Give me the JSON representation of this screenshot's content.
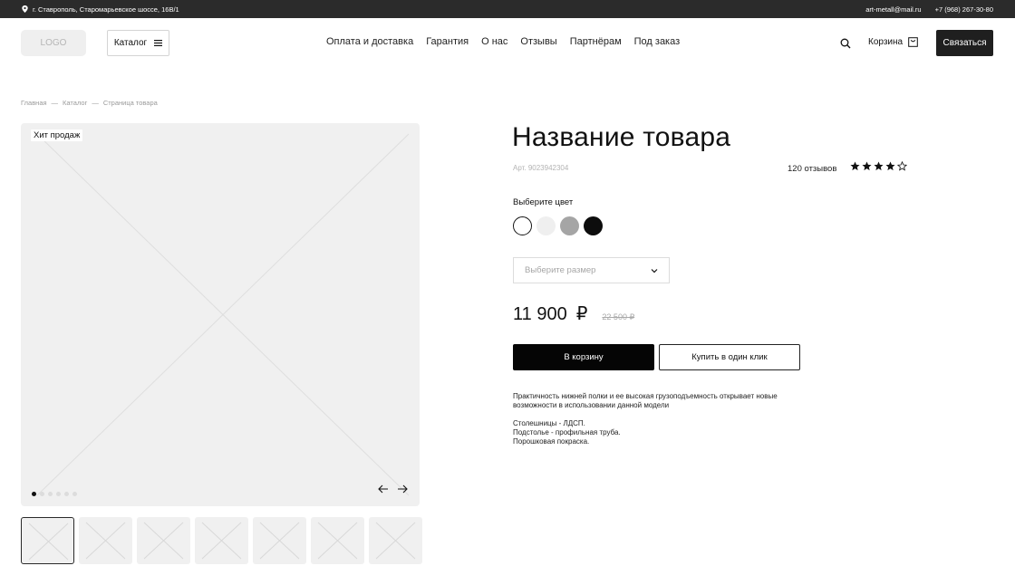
{
  "topbar": {
    "address": "г. Ставрополь, Старомарьевское шоссе, 16В/1",
    "email": "art-metall@mail.ru",
    "phone": "+7 (968) 267-30-80"
  },
  "header": {
    "logo": "LOGO",
    "catalog_label": "Каталог",
    "nav": [
      "Оплата и доставка",
      "Гарантия",
      "О нас",
      "Отзывы",
      "Партнёрам",
      "Под заказ"
    ],
    "cart_label": "Корзина",
    "contact_label": "Связаться"
  },
  "breadcrumb": [
    "Главная",
    "—",
    "Каталог",
    "—",
    "Страница товара"
  ],
  "gallery": {
    "badge": "Хит продаж",
    "slides": 6,
    "active_slide": 1,
    "thumbnails": 7,
    "active_thumbnail": 1
  },
  "product": {
    "title": "Название товара",
    "sku": "Арт. 9023942304",
    "reviews": "120 отзывов",
    "rating": 4,
    "rating_max": 5,
    "color_label": "Выберите цвет",
    "colors": [
      "#ffffff",
      "#efefef",
      "#a5a5a5",
      "#0d0d0d"
    ],
    "selected_color": 0,
    "size_placeholder": "Выберите размер",
    "price": "11 900",
    "currency": "₽",
    "old_price": "22 500 ₽",
    "add_to_cart": "В корзину",
    "buy_one_click": "Купить в один клик",
    "description": "Практичность нижней полки и ее высокая грузоподъемность открывает новые возможности в использовании данной модели",
    "features": [
      "Столешницы - ЛДСП.",
      "Подстолье - профильная труба.",
      "Порошковая покраска."
    ]
  }
}
